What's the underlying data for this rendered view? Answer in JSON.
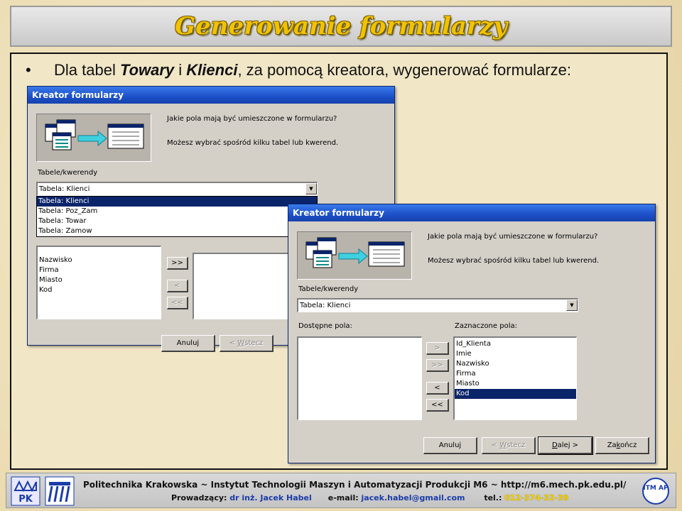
{
  "title": "Generowanie formularzy",
  "bullet": {
    "pre": "Dla tabel ",
    "t1": "Towary",
    "mid": " i ",
    "t2": "Klienci",
    "post": ", za pomocą kreatora, wygenerować formularze:"
  },
  "dialog1": {
    "title": "Kreator formularzy",
    "question": "Jakie pola mają być umieszczone w formularzu?",
    "hint": "Możesz wybrać spośród kilku tabel lub kwerend.",
    "tables_label": "Tabele/kwerendy",
    "combo_value": "Tabela: Klienci",
    "dropdown_items": [
      "Tabela: Klienci",
      "Tabela: Poz_Zam",
      "Tabela: Towar",
      "Tabela: Zamow"
    ],
    "list_items": [
      "Nazwisko",
      "Firma",
      "Miasto",
      "Kod"
    ],
    "move_all": ">>",
    "back_one": "<",
    "back_all": "<<",
    "cancel": "Anuluj",
    "back_pre": "< ",
    "back_ul": "W",
    "back_post": "stecz"
  },
  "dialog2": {
    "title": "Kreator formularzy",
    "question": "Jakie pola mają być umieszczone w formularzu?",
    "hint": "Możesz wybrać spośród kilku tabel lub kwerend.",
    "tables_label": "Tabele/kwerendy",
    "combo_value": "Tabela: Klienci",
    "available_label": "Dostępne pola:",
    "selected_label": "Zaznaczone pola:",
    "selected_items": [
      "Id_Klienta",
      "Imie",
      "Nazwisko",
      "Firma",
      "Miasto",
      "Kod"
    ],
    "selected_index": 5,
    "move_one": ">",
    "move_all": ">>",
    "back_one": "<",
    "back_all": "<<",
    "cancel": "Anuluj",
    "back_pre": "< ",
    "back_ul": "W",
    "back_post": "stecz",
    "next_pre": "",
    "next_ul": "D",
    "next_post": "alej >",
    "finish_pre": "Za",
    "finish_ul": "k",
    "finish_post": "ończ"
  },
  "footer": {
    "line1": "Politechnika Krakowska   ~   Instytut Technologii Maszyn i Automatyzacji Produkcji M6   ~   http://m6.mech.pk.edu.pl/",
    "lead_label": "Prowadzący: ",
    "lead_name": "dr inż. Jacek Habel",
    "email_label": "e-mail: ",
    "email": "jacek.habel@gmail.com",
    "tel_label": "tel.: ",
    "tel": "012-374-32-39",
    "logo_pk_text": "PK",
    "logo_imap_text": "ITM AP"
  },
  "colors": {
    "title_text": "#f2c200",
    "dialog_title": "#1c4fc8",
    "selection": "#0a246a",
    "footer_blue": "#1a3caa",
    "footer_yellow": "#f4d000"
  }
}
